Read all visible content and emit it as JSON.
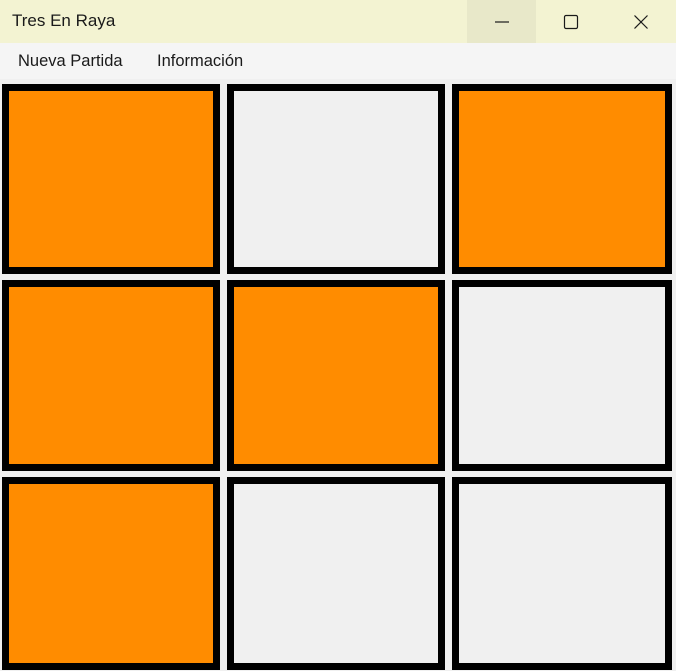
{
  "window": {
    "title": "Tres En Raya"
  },
  "menu": {
    "items": [
      {
        "label": "Nueva Partida"
      },
      {
        "label": "Información"
      }
    ]
  },
  "board": {
    "cells": [
      {
        "state": "orange"
      },
      {
        "state": "empty"
      },
      {
        "state": "orange"
      },
      {
        "state": "orange"
      },
      {
        "state": "orange"
      },
      {
        "state": "empty"
      },
      {
        "state": "orange"
      },
      {
        "state": "empty"
      },
      {
        "state": "empty"
      }
    ]
  },
  "colors": {
    "titlebar": "#f3f3d2",
    "cell_marked": "#ff8c00",
    "cell_empty": "#f0f0f0",
    "cell_border": "#000000"
  },
  "icons": {
    "minimize": "minimize-icon",
    "maximize": "maximize-icon",
    "close": "close-icon"
  }
}
